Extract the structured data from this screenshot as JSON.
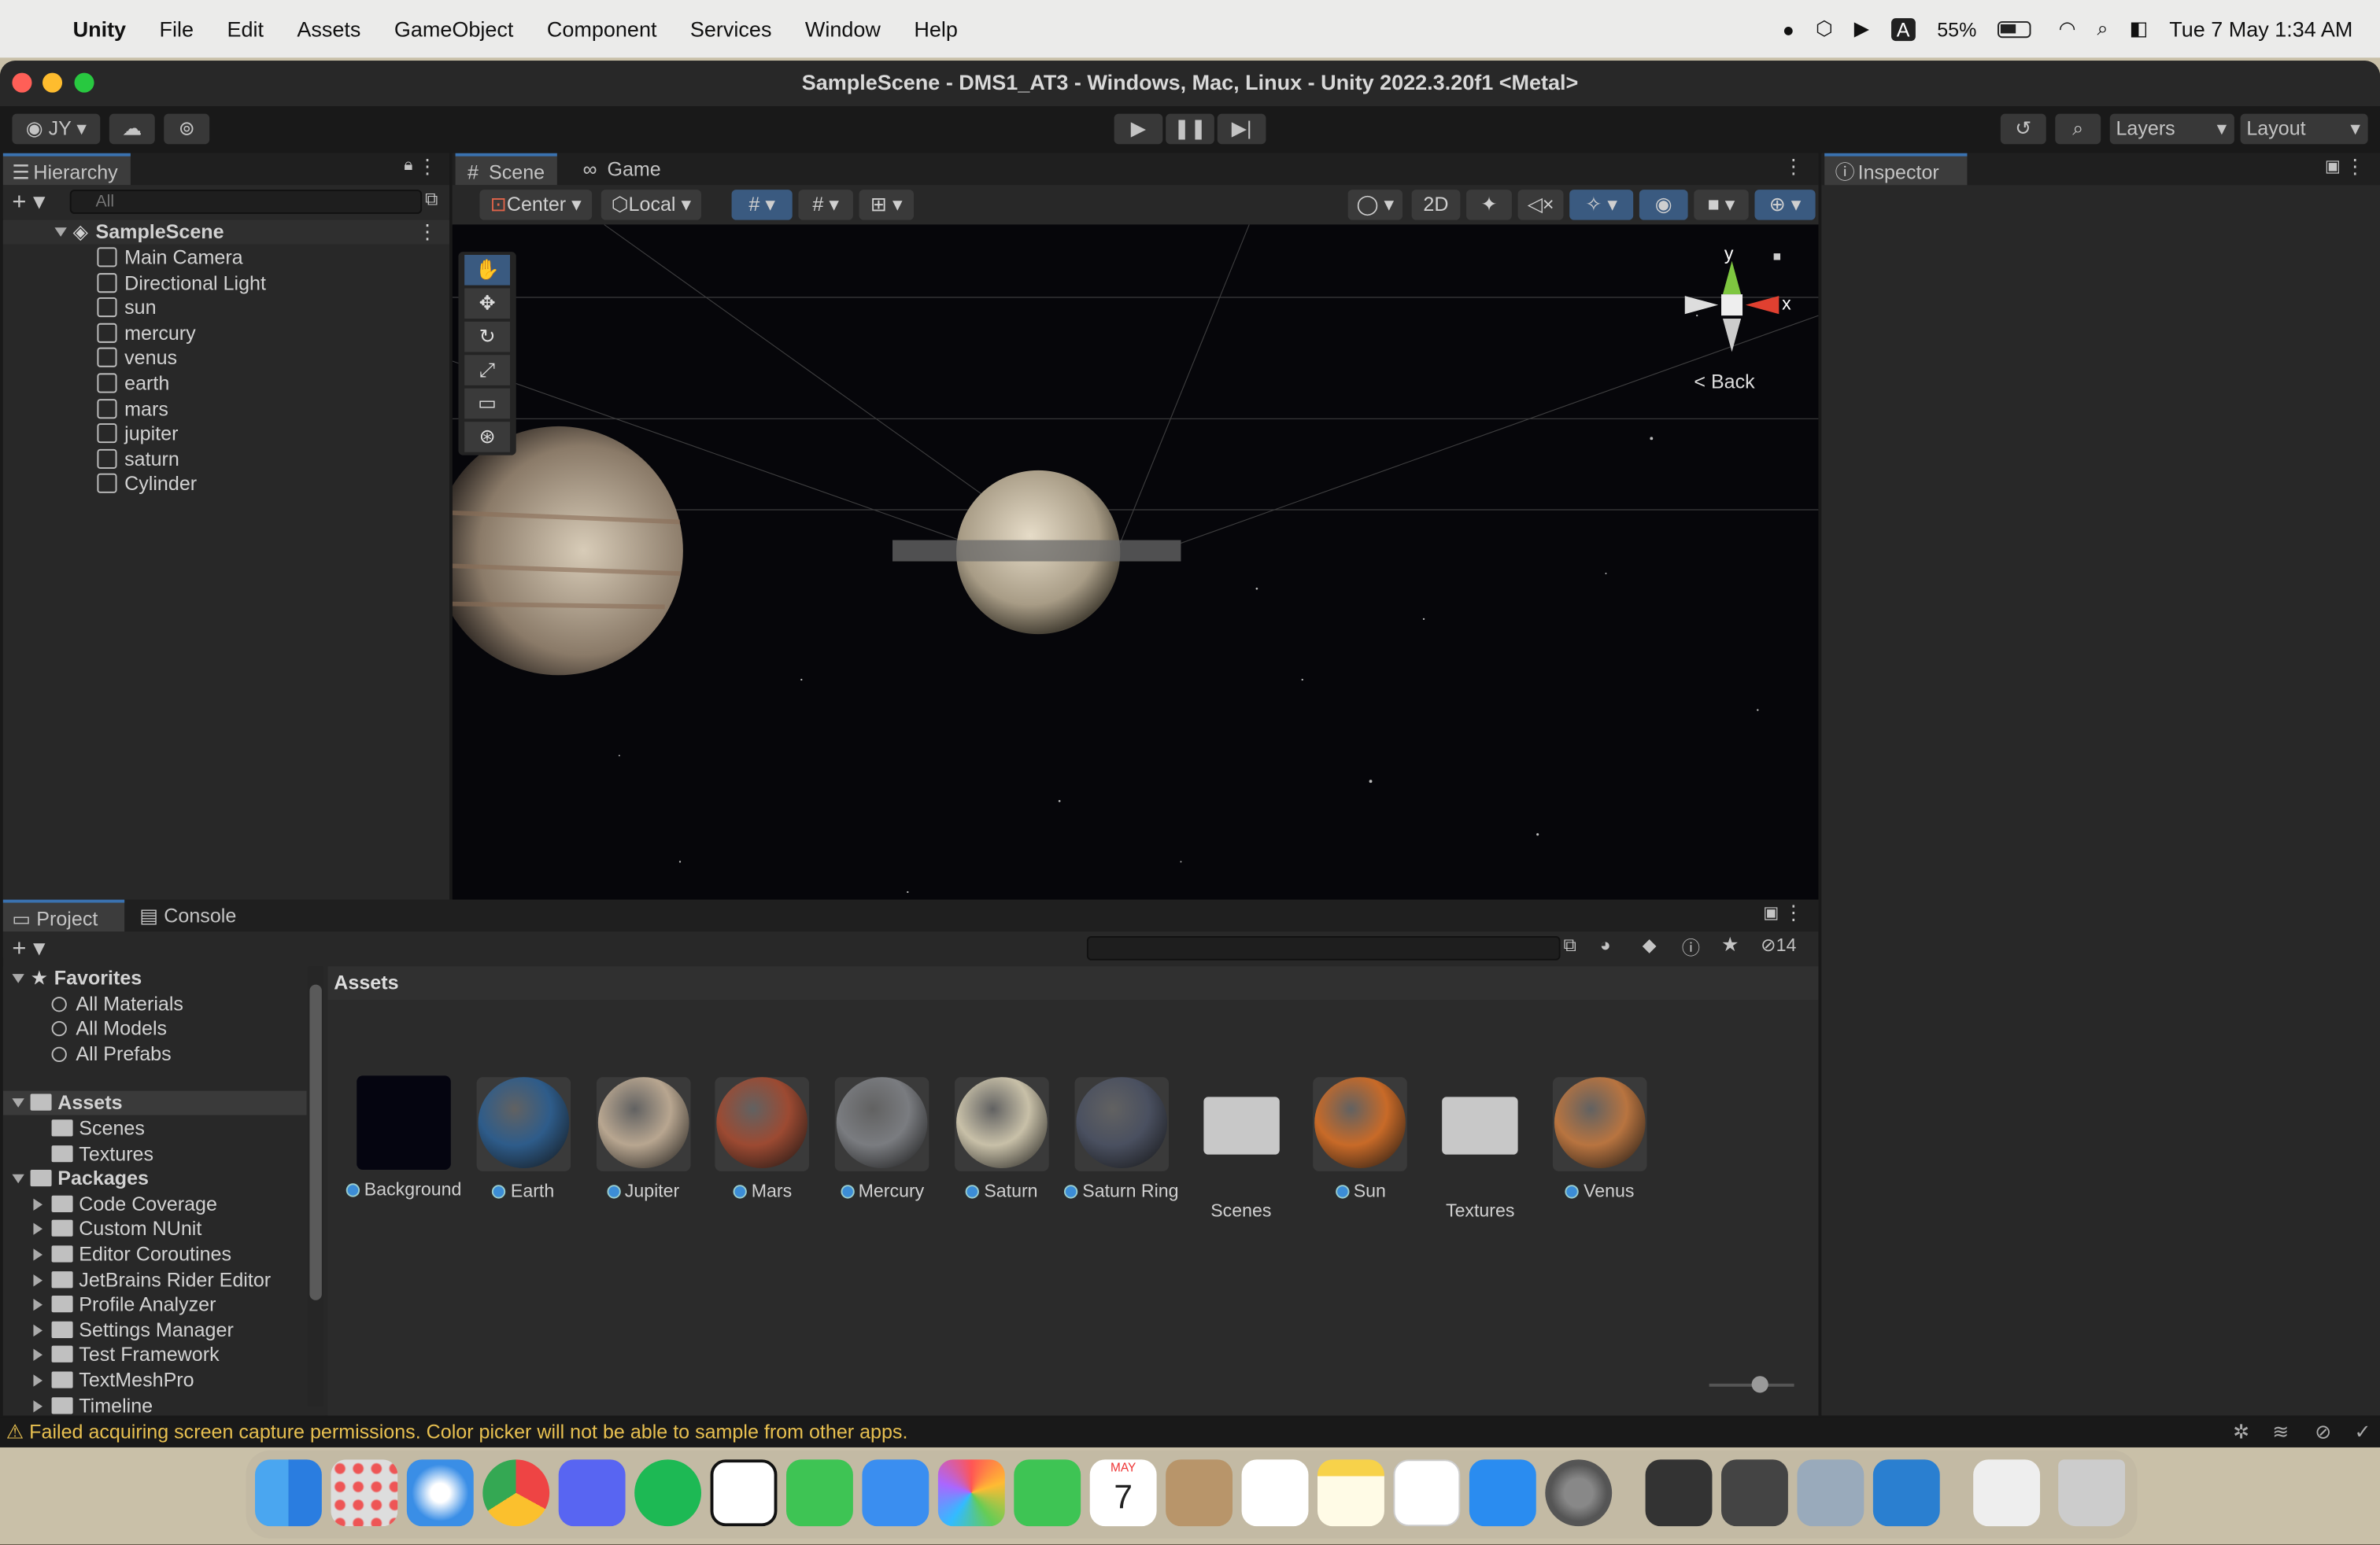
{
  "menubar": {
    "app": "Unity",
    "items": [
      "File",
      "Edit",
      "Assets",
      "GameObject",
      "Component",
      "Services",
      "Window",
      "Help"
    ],
    "battery": "55%",
    "datetime": "Tue 7 May  1:34 AM"
  },
  "window": {
    "title": "SampleScene - DMS1_AT3 - Windows, Mac, Linux - Unity 2022.3.20f1 <Metal>"
  },
  "toolbar": {
    "account": "JY",
    "layers": "Layers",
    "layout": "Layout"
  },
  "hierarchy": {
    "tab": "Hierarchy",
    "search_placeholder": "All",
    "scene": "SampleScene",
    "items": [
      "Main Camera",
      "Directional Light",
      "sun",
      "mercury",
      "venus",
      "earth",
      "mars",
      "jupiter",
      "saturn",
      "Cylinder"
    ]
  },
  "scene": {
    "tabs": [
      "Scene",
      "Game"
    ],
    "pivot": "Center",
    "space": "Local",
    "mode2d": "2D",
    "gizmo_y": "y",
    "gizmo_x": "x",
    "gizmo_view": "Back"
  },
  "inspector": {
    "tab": "Inspector"
  },
  "project": {
    "tabs": [
      "Project",
      "Console"
    ],
    "breadcrumb": "Assets",
    "hidden_count": "14",
    "favorites": {
      "label": "Favorites",
      "items": [
        "All Materials",
        "All Models",
        "All Prefabs"
      ]
    },
    "assets_root": {
      "label": "Assets",
      "items": [
        "Scenes",
        "Textures"
      ]
    },
    "packages": {
      "label": "Packages",
      "items": [
        "Code Coverage",
        "Custom NUnit",
        "Editor Coroutines",
        "JetBrains Rider Editor",
        "Profile Analyzer",
        "Settings Manager",
        "Test Framework",
        "TextMeshPro",
        "Timeline"
      ]
    },
    "assets": [
      {
        "name": "Background",
        "kind": "material",
        "color": "#050510"
      },
      {
        "name": "Earth",
        "kind": "material",
        "color": "#2e5c8a"
      },
      {
        "name": "Jupiter",
        "kind": "material",
        "color": "#b8a690"
      },
      {
        "name": "Mars",
        "kind": "material",
        "color": "#9c4a32"
      },
      {
        "name": "Mercury",
        "kind": "material",
        "color": "#7a7c80"
      },
      {
        "name": "Saturn",
        "kind": "material",
        "color": "#c8c0a8"
      },
      {
        "name": "Saturn Ring",
        "kind": "material",
        "color": "#4a5060"
      },
      {
        "name": "Scenes",
        "kind": "folder",
        "color": "#c8c8c8"
      },
      {
        "name": "Sun",
        "kind": "material",
        "color": "#c86a28"
      },
      {
        "name": "Textures",
        "kind": "folder",
        "color": "#c8c8c8"
      },
      {
        "name": "Venus",
        "kind": "material",
        "color": "#b87440"
      }
    ]
  },
  "status": {
    "message": "Failed acquiring screen capture permissions. Color picker will not be able to sample from other apps."
  },
  "dock": {
    "calendar_month": "MAY",
    "calendar_day": "7"
  }
}
